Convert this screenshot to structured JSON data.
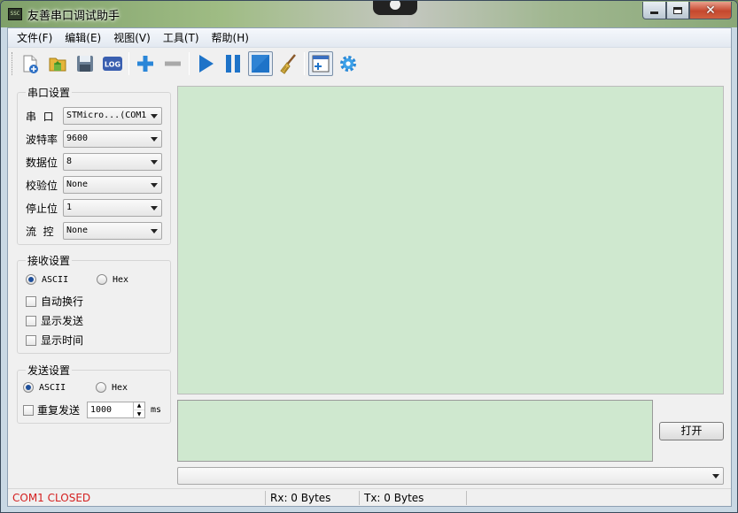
{
  "window": {
    "title": "友善串口调试助手",
    "icon_text": "SSC",
    "close_glyph": "✕"
  },
  "menu": [
    {
      "label": "文件(F)"
    },
    {
      "label": "编辑(E)"
    },
    {
      "label": "视图(V)"
    },
    {
      "label": "工具(T)"
    },
    {
      "label": "帮助(H)"
    }
  ],
  "toolbar": {
    "icons": [
      "new-file-icon",
      "open-folder-icon",
      "save-icon",
      "log-icon",
      "add-icon",
      "remove-icon",
      "play-icon",
      "pause-icon",
      "stop-icon",
      "clear-broom-icon",
      "add-window-icon",
      "settings-gear-icon"
    ],
    "log_text": "LOG"
  },
  "serial_settings": {
    "title": "串口设置",
    "port": {
      "label": "串  口",
      "value": "STMicro...(COM1"
    },
    "baud": {
      "label": "波特率",
      "value": "9600"
    },
    "databits": {
      "label": "数据位",
      "value": "8"
    },
    "parity": {
      "label": "校验位",
      "value": "None"
    },
    "stopbits": {
      "label": "停止位",
      "value": "1"
    },
    "flow": {
      "label": "流  控",
      "value": "None"
    }
  },
  "receive_settings": {
    "title": "接收设置",
    "ascii": "ASCII",
    "hex": "Hex",
    "auto_wrap": "自动换行",
    "show_send": "显示发送",
    "show_time": "显示时间"
  },
  "send_settings": {
    "title": "发送设置",
    "ascii": "ASCII",
    "hex": "Hex",
    "repeat": "重复发送",
    "interval": "1000",
    "unit": "ms"
  },
  "buttons": {
    "open": "打开"
  },
  "status": {
    "port_state": "COM1 CLOSED",
    "rx": "Rx: 0 Bytes",
    "tx": "Tx: 0 Bytes"
  },
  "colors": {
    "status_closed": "#d42020",
    "data_area": "#cfe8cf",
    "accent_blue": "#1e73c8"
  }
}
